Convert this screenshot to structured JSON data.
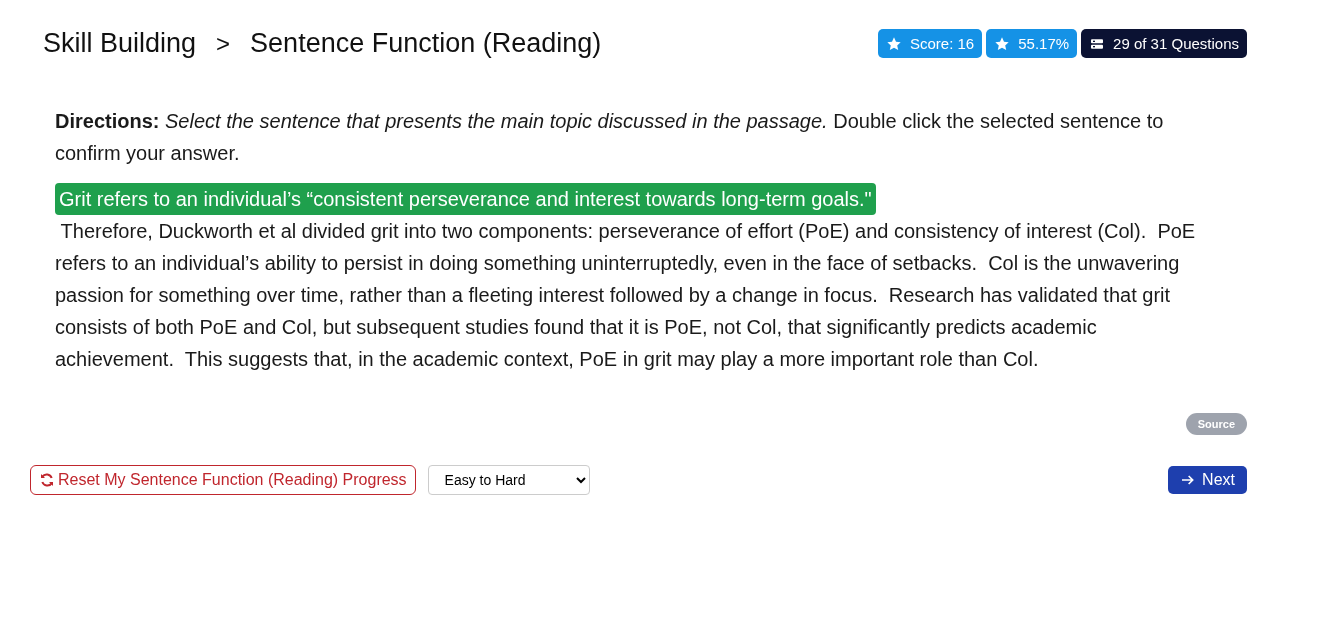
{
  "breadcrumb": {
    "section": "Skill Building",
    "separator": ">",
    "page": "Sentence Function (Reading)"
  },
  "stats": [
    {
      "kind": "star",
      "text": "Score: 16"
    },
    {
      "kind": "star",
      "text": "55.17%"
    },
    {
      "kind": "questions",
      "text": "29 of 31 Questions"
    }
  ],
  "directions": {
    "label": "Directions:",
    "instruction": "Select the sentence that presents the main topic discussed in the passage.",
    "note": "Double click the selected sentence to confirm your answer."
  },
  "sentences": [
    {
      "text": "Grit refers to an individual’s “consistent perseverance and interest towards long-term goals.\"",
      "selected": true
    },
    {
      "text": "Therefore, Duckworth et al divided grit into two components: perseverance of effort (PoE) and consistency of interest (Col).",
      "selected": false
    },
    {
      "text": "PoE refers to an individual’s ability to persist in doing something uninterruptedly, even in the face of setbacks.",
      "selected": false
    },
    {
      "text": "Col is the unwavering passion for something over time, rather than a fleeting interest followed by a change in focus.",
      "selected": false
    },
    {
      "text": "Research has validated that grit consists of both PoE and Col, but subsequent studies found that it is PoE, not Col, that significantly predicts academic achievement.",
      "selected": false
    },
    {
      "text": "This suggests that, in the academic context, PoE in grit may play a more important role than Col.",
      "selected": false
    }
  ],
  "source_button": "Source",
  "reset_button": "Reset My Sentence Function (Reading) Progress",
  "order_select": {
    "value": "Easy to Hard"
  },
  "next_button": "Next"
}
